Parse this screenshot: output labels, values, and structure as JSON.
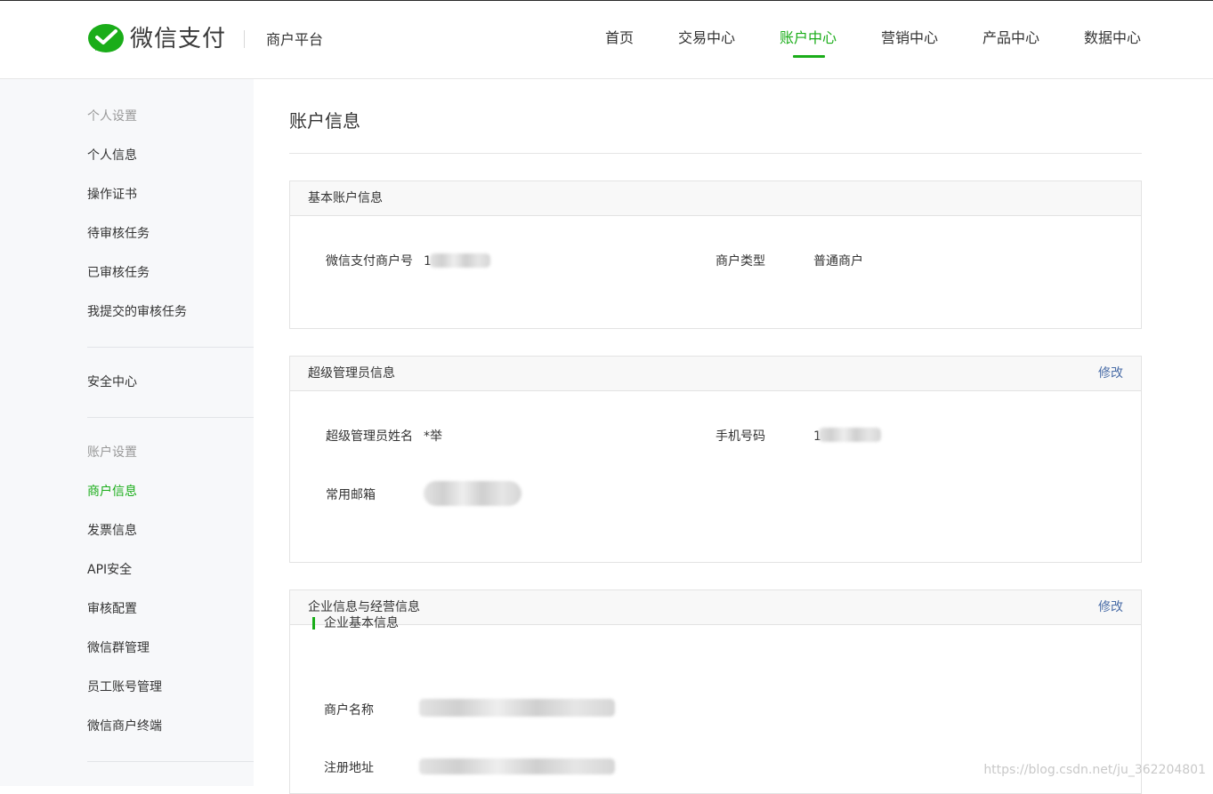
{
  "header": {
    "brand": "微信支付",
    "platform": "商户平台",
    "nav": [
      "首页",
      "交易中心",
      "账户中心",
      "营销中心",
      "产品中心",
      "数据中心"
    ],
    "active_nav": "账户中心"
  },
  "sidebar": {
    "group_personal": "个人设置",
    "personal_items": [
      "个人信息",
      "操作证书",
      "待审核任务",
      "已审核任务",
      "我提交的审核任务"
    ],
    "security": "安全中心",
    "group_account": "账户设置",
    "account_items": [
      "商户信息",
      "发票信息",
      "API安全",
      "审核配置",
      "微信群管理",
      "员工账号管理",
      "微信商户终端"
    ],
    "active_item": "商户信息"
  },
  "main": {
    "title": "账户信息",
    "basic": {
      "title": "基本账户信息",
      "merchant_id_label": "微信支付商户号",
      "merchant_id_value": "1",
      "merchant_type_label": "商户类型",
      "merchant_type_value": "普通商户"
    },
    "admin": {
      "title": "超级管理员信息",
      "action": "修改",
      "name_label": "超级管理员姓名",
      "name_value": "*举",
      "phone_label": "手机号码",
      "phone_value": "1",
      "email_label": "常用邮箱"
    },
    "company": {
      "title": "企业信息与经营信息",
      "action": "修改",
      "subsection": "企业基本信息",
      "name_label": "商户名称",
      "address_label": "注册地址"
    }
  },
  "watermark": "https://blog.csdn.net/ju_362204801",
  "colors": {
    "accent": "#1aad19",
    "link": "#4a6da7",
    "sidebar_bg": "#f7f8fa"
  }
}
